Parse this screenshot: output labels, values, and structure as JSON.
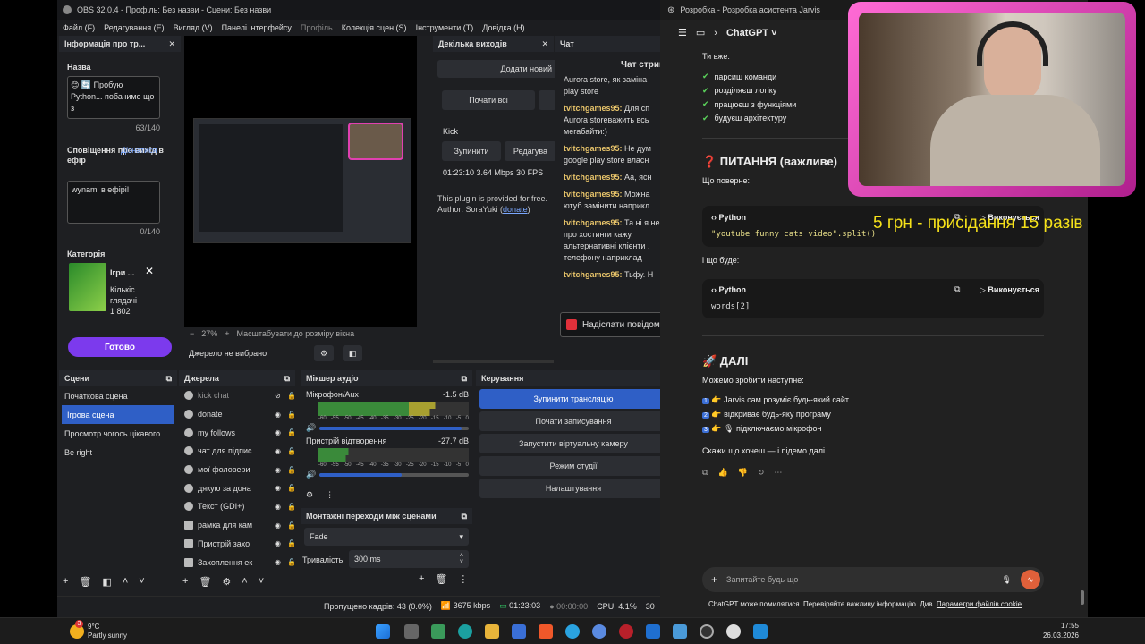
{
  "obs": {
    "title": "OBS 32.0.4 - Профіль: Без назви - Сцени: Без назви",
    "menu": [
      "Файл (F)",
      "Редагування (E)",
      "Вигляд (V)",
      "Панелі інтерфейсу",
      "Профіль",
      "Колекція сцен (S)",
      "Інструменти (T)",
      "Довідка (H)"
    ],
    "info_dock": {
      "title": "Інформація про тр...",
      "name_label": "Назва",
      "name_value": "😊 🔄 Пробую Python... побачимо що з",
      "name_count": "63/140",
      "notif_label": "Сповіщення про вихід в ефір",
      "notif_link1": "Дізнатися",
      "notif_link2": "більше",
      "notif_value": "wynami в ефірі!",
      "notif_count": "0/140",
      "category_label": "Категорія",
      "category_name": "Ігри ...",
      "category_viewers_label": "Кількіс глядачі",
      "category_viewers": "1 802",
      "done_button": "Готово"
    },
    "preview": {
      "zoom": "27%",
      "scale_label": "Масштабувати до розміру вікна",
      "source_status": "Джерело не вибрано"
    },
    "multi_output": {
      "title": "Декілька виходів",
      "add_button": "Додати новий",
      "start_all": "Почати всі",
      "platform": "Kick",
      "stop_button": "Зупинити",
      "edit_button": "Редагува",
      "stats": "01:23:10  3.64 Mbps  30 FPS",
      "plugin_note": "This plugin is provided for free. Author: SoraYuki (",
      "donate_link": "donate",
      "plugin_note_end": ")"
    },
    "chat": {
      "title": "Чат",
      "header": "Чат стрим",
      "intro": "Aurora store, як заміна play store",
      "messages": [
        {
          "user": "tvitchgames95:",
          "text": "Для сп Aurora storeважить всь мегабайти:)"
        },
        {
          "user": "tvitchgames95:",
          "text": "Не дум google play store власн"
        },
        {
          "user": "tvitchgames95:",
          "text": "Аа, ясн"
        },
        {
          "user": "tvitchgames95:",
          "text": "Можна ютуб замінити наприкл"
        },
        {
          "user": "tvitchgames95:",
          "text": "Та ні я не про хостинги кажу, альтернативні клієнти , телефону наприклад"
        },
        {
          "user": "tvitchgames95:",
          "text": "Тьфу. Н"
        }
      ],
      "send_placeholder": "Надіслати повідом"
    },
    "scenes": {
      "title": "Сцени",
      "items": [
        "Початкова сцена",
        "Ігрова сцена",
        "Просмотр чогось цікавого",
        "Be right"
      ],
      "selected_index": 1
    },
    "sources": {
      "title": "Джерела",
      "items": [
        "kick chat",
        "donate",
        "my follows",
        "чат для підпис",
        "мої фоловери",
        "дякую за дона",
        "Текст (GDI+)",
        "рамка для кам",
        "Пристрій захо",
        "Захоплення ек"
      ]
    },
    "mixer": {
      "title": "Мікшер аудіо",
      "channels": [
        {
          "name": "Мікрофон/Aux",
          "db": "-1.5 dB",
          "level": 0.78,
          "volume": 0.95
        },
        {
          "name": "Пристрій відтворення",
          "db": "-27.7 dB",
          "level": 0.2,
          "volume": 0.55
        }
      ],
      "scale": [
        "-60",
        "-55",
        "-50",
        "-45",
        "-40",
        "-35",
        "-30",
        "-25",
        "-20",
        "-15",
        "-10",
        "-5",
        "0"
      ]
    },
    "transitions": {
      "title": "Монтажні переходи між сценами",
      "type": "Fade",
      "duration_label": "Тривалість",
      "duration": "300 ms"
    },
    "controls": {
      "title": "Керування",
      "buttons": [
        "Зупинити трансляцію",
        "Почати записування",
        "Запустити віртуальну камеру",
        "Режим студії",
        "Налаштування"
      ]
    },
    "status": {
      "dropped": "Пропущено кадрів: 43 (0.0%)",
      "bitrate": "3675 kbps",
      "live": "01:23:03",
      "rec": "00:00:00",
      "cpu": "CPU: 4.1%",
      "fps": "30"
    }
  },
  "gpt": {
    "window_title": "Розробка - Розробка асистента Jarvis",
    "model": "ChatGPT",
    "intro": "Ти вже:",
    "checks": [
      "парсиш команди",
      "розділяєш логіку",
      "працюєш з функціями",
      "будуєш архітектуру"
    ],
    "question_heading": "❓ ПИТАННЯ (важливе)",
    "what_returns": "Що поверне:",
    "code_lang": "Python",
    "run_label": "Виконується",
    "code1": "\"youtube funny cats video\".split()",
    "what_happens": "і що буде:",
    "code2": "words[2]",
    "next_heading": "🚀 ДАЛІ",
    "next_intro": "Можемо зробити наступне:",
    "next_items": [
      "👉 Jarvis сам розуміє будь-який сайт",
      "👉 відкриває будь-яку програму",
      "👉 🎙 підключаємо мікрофон"
    ],
    "outro": "Скажи що хочеш — і підемо далі.",
    "input_placeholder": "Запитайте будь-що",
    "disclaimer": "ChatGPT може помилятися. Перевіряйте важливу інформацію. Див.",
    "disclaimer_link": "Параметри файлів cookie",
    "disclaimer_end": "."
  },
  "overlay_text": "5 грн - присідання 15 разів",
  "taskbar": {
    "weather_temp": "9°C",
    "weather_desc": "Partly sunny",
    "badge": "3",
    "time": "17:55",
    "date": "26.03.2026"
  },
  "colors": {
    "accent": "#2f5fc6",
    "live_button": "#7c3aed",
    "overlay_yellow": "#f5e11a",
    "frame_pink": "#e040b0"
  }
}
